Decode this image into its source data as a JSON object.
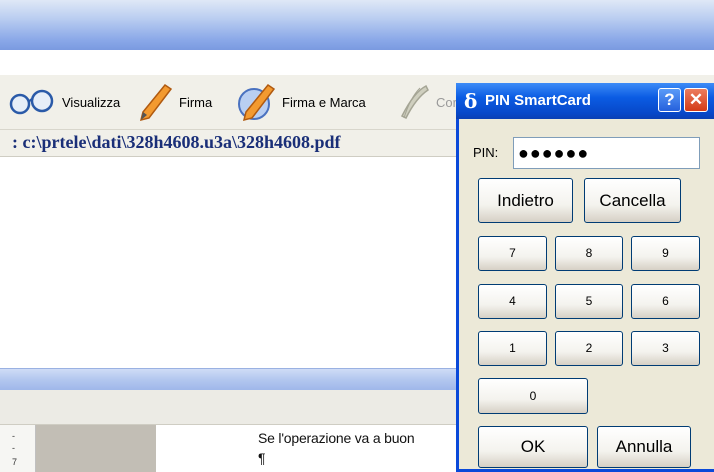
{
  "toolbar": {
    "items": [
      {
        "label": "Visualizza",
        "icon": "glasses-icon"
      },
      {
        "label": "Firma",
        "icon": "pen-icon"
      },
      {
        "label": "Firma e Marca",
        "icon": "pen-stamp-icon"
      },
      {
        "label": "Cor",
        "icon": "feather-icon"
      }
    ]
  },
  "path": ": c:\\prtele\\dati\\328h4608.u3a\\328h4608.pdf",
  "document": {
    "text": "Se l'operazione va a buon",
    "pilcrow": "¶"
  },
  "dialog": {
    "title": "PIN SmartCard",
    "logo": "δ",
    "help_label": "?",
    "close_label": "✕",
    "pin_label": "PIN:",
    "pin_value": "●●●●●●",
    "back_label": "Indietro",
    "clear_label": "Cancella",
    "keys": [
      "7",
      "8",
      "9",
      "4",
      "5",
      "6",
      "1",
      "2",
      "3",
      "0"
    ],
    "ok_label": "OK",
    "cancel_label": "Annulla"
  },
  "colors": {
    "accent": "#0b5ce3",
    "path_text": "#1a2f78",
    "close": "#d33a17"
  }
}
